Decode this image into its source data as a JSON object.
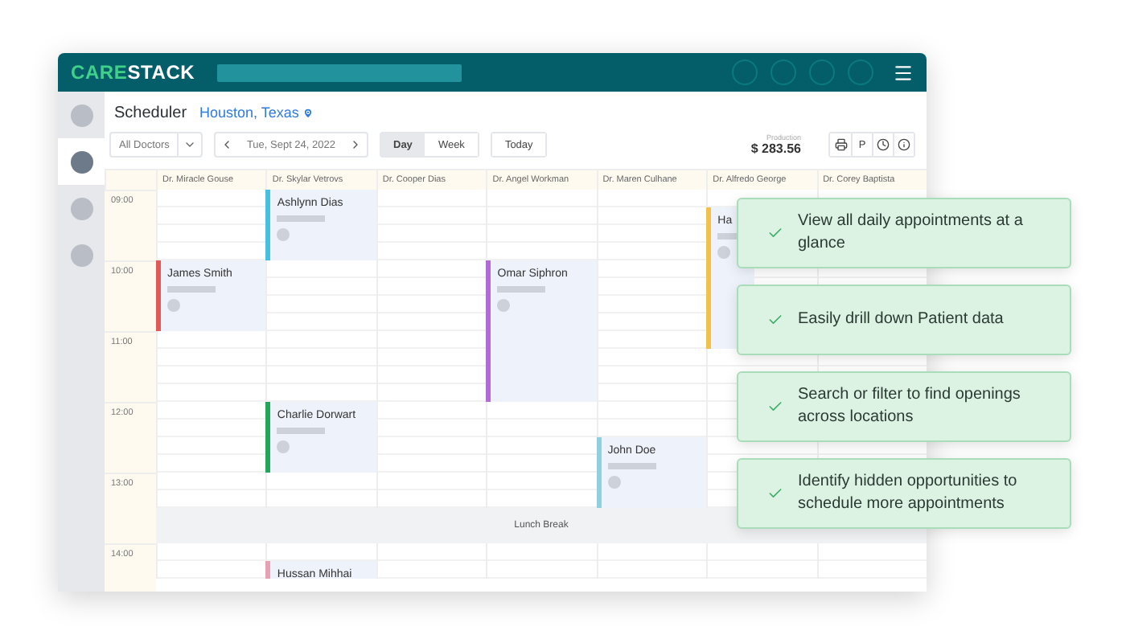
{
  "header": {
    "logo": [
      "CARE",
      "STACK"
    ]
  },
  "sidebar": {
    "items": [
      {
        "selected": false
      },
      {
        "selected": true
      },
      {
        "selected": false
      },
      {
        "selected": false
      }
    ]
  },
  "title": "Scheduler",
  "location": "Houston, Texas",
  "toolbar": {
    "doctor_filter": "All Doctors",
    "date": "Tue, Sept 24, 2022",
    "views": [
      {
        "label": "Day",
        "selected": true
      },
      {
        "label": "Week",
        "selected": false
      }
    ],
    "today": "Today",
    "production_label": "Production",
    "production_value": "$ 283.56",
    "actions": [
      {
        "kind": "print"
      },
      {
        "kind": "text",
        "label": "P"
      },
      {
        "kind": "clock"
      },
      {
        "kind": "info"
      }
    ]
  },
  "hours": [
    "09:00",
    "10:00",
    "11:00",
    "12:00",
    "13:00",
    "14:00"
  ],
  "doctors": [
    {
      "name": "Dr. Miracle Gouse",
      "appointments": [
        {
          "patient": "James Smith",
          "color": "#e05a5a"
        }
      ]
    },
    {
      "name": "Dr. Skylar Vetrovs",
      "appointments": [
        {
          "patient": "Ashlynn Dias",
          "color": "#45c0e2"
        },
        {
          "patient": "Charlie Dorwart",
          "color": "#25a55a"
        },
        {
          "patient": "Hussan Mihhai",
          "color": "#e8a0b4"
        }
      ]
    },
    {
      "name": "Dr. Cooper Dias"
    },
    {
      "name": "Dr. Angel Workman",
      "appointments": [
        {
          "patient": "Omar Siphron",
          "color": "#b06bd6"
        }
      ]
    },
    {
      "name": "Dr. Maren Culhane",
      "appointments": [
        {
          "patient": "John Doe",
          "color": "#8fd0da"
        }
      ]
    },
    {
      "name": "Dr. Alfredo George",
      "appointments": [
        {
          "patient": "Ha",
          "color": "#f0c24b"
        }
      ]
    },
    {
      "name": "Dr. Corey Baptista"
    }
  ],
  "lunch": {
    "label": "Lunch Break"
  },
  "features": [
    "View all daily appointments at a glance",
    "Easily drill down Patient data",
    "Search or filter to find openings across locations",
    "Identify hidden opportunities to schedule more appointments"
  ]
}
